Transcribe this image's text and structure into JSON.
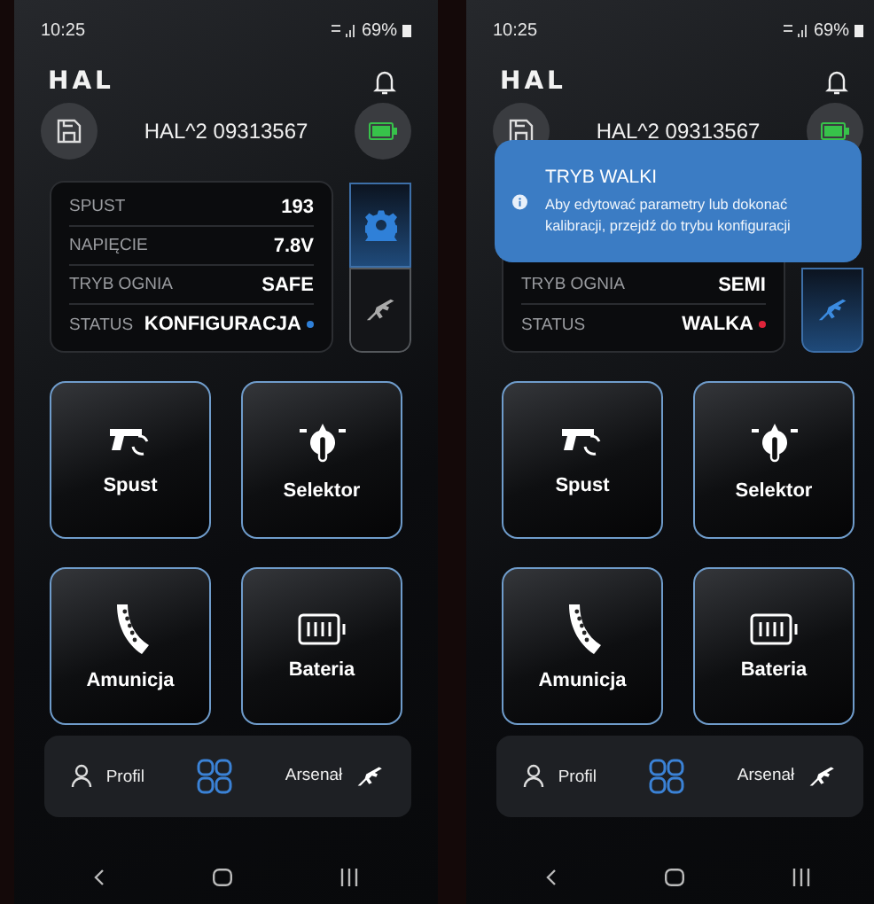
{
  "screens": [
    {
      "status_bar": {
        "time": "10:25",
        "battery": "69%"
      },
      "logo": "HAL",
      "device_name": "HAL^2 09313567",
      "stats": [
        {
          "label": "SPUST",
          "value": "193"
        },
        {
          "label": "NAPIĘCIE",
          "value": "7.8V"
        },
        {
          "label": "TRYB OGNIA",
          "value": "SAFE"
        },
        {
          "label": "STATUS",
          "value": "KONFIGURACJA",
          "color": "#2f80d8"
        }
      ],
      "side_tabs": [
        {
          "kind": "settings",
          "selected": true
        },
        {
          "kind": "rifle",
          "selected": false
        }
      ],
      "tiles": [
        {
          "kind": "trigger",
          "label": "Spust"
        },
        {
          "kind": "selector",
          "label": "Selektor"
        },
        {
          "kind": "ammo",
          "label": "Amunicja"
        },
        {
          "kind": "battery",
          "label": "Bateria"
        }
      ],
      "nav": [
        {
          "kind": "profile",
          "label": "Profil",
          "selected": false
        },
        {
          "kind": "grid",
          "selected": true
        },
        {
          "kind": "arsenal",
          "label": "Arsenał",
          "selected": false
        }
      ]
    },
    {
      "status_bar": {
        "time": "10:25",
        "battery": "69%"
      },
      "logo": "HAL",
      "device_name": "HAL^2 09313567",
      "toast": {
        "title": "TRYB WALKI",
        "message": "Aby edytować parametry lub dokonać kalibracji, przejdź do trybu konfiguracji"
      },
      "stats": [
        {
          "label": "TRYB OGNIA",
          "value": "SEMI"
        },
        {
          "label": "STATUS",
          "value": "WALKA",
          "color": "#e0243a"
        }
      ],
      "side_tabs": [
        {
          "kind": "rifle",
          "selected": true
        }
      ],
      "tiles": [
        {
          "kind": "trigger",
          "label": "Spust"
        },
        {
          "kind": "selector",
          "label": "Selektor"
        },
        {
          "kind": "ammo",
          "label": "Amunicja"
        },
        {
          "kind": "battery",
          "label": "Bateria"
        }
      ],
      "nav": [
        {
          "kind": "profile",
          "label": "Profil",
          "selected": false
        },
        {
          "kind": "grid",
          "selected": true
        },
        {
          "kind": "arsenal",
          "label": "Arsenał",
          "selected": false
        }
      ]
    }
  ]
}
